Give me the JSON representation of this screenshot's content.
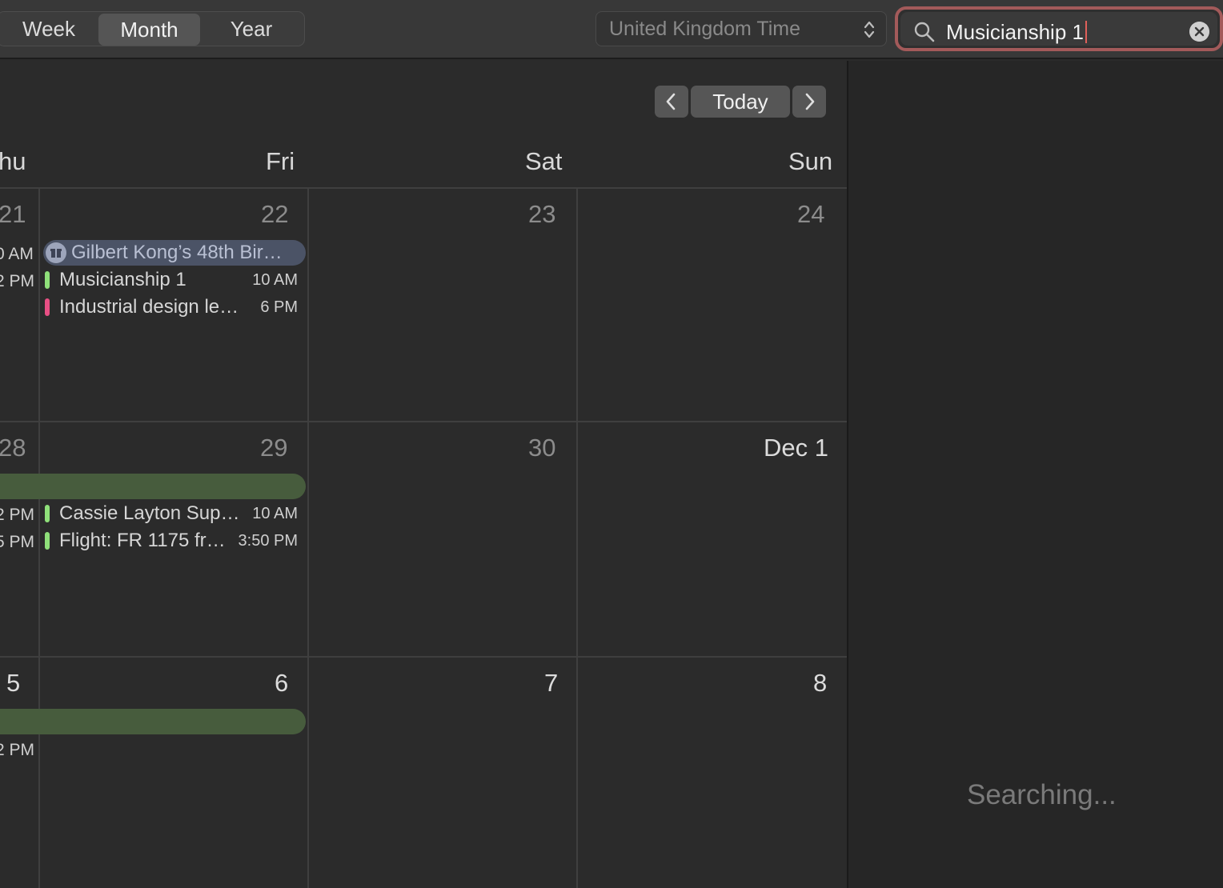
{
  "toolbar": {
    "views": [
      "Week",
      "Month",
      "Year"
    ],
    "selected_view": "Month",
    "timezone": "United Kingdom Time",
    "search_query": "Musicianship 1"
  },
  "nav": {
    "today_label": "Today"
  },
  "weekdays": [
    "hu",
    "Fri",
    "Sat",
    "Sun"
  ],
  "weeks": [
    {
      "days": [
        "21",
        "22",
        "23",
        "24"
      ],
      "thu_partial_times": [
        "AM",
        "PM"
      ],
      "fri_events": [
        {
          "kind": "birthday",
          "title": "Gilbert Kong’s 48th Bir…",
          "icon": "gift-icon"
        },
        {
          "title": "Musicianship 1",
          "time": "10 AM",
          "color": "#8fe07a"
        },
        {
          "title": "Industrial design le…",
          "time": "6 PM",
          "color": "#e84f84"
        }
      ]
    },
    {
      "days": [
        "28",
        "29",
        "30",
        "Dec 1"
      ],
      "thu_partial_times": [
        "PM",
        "PM"
      ],
      "fri_events": [
        {
          "title": "Cassie Layton Sup…",
          "time": "10 AM",
          "color": "#8fe07a"
        },
        {
          "title": "Flight: FR 1175 fr…",
          "time": "3:50 PM",
          "color": "#8fe07a"
        }
      ]
    },
    {
      "days": [
        "5",
        "6",
        "7",
        "8"
      ],
      "thu_partial_times": [
        "PM"
      ]
    }
  ],
  "results_panel": {
    "status": "Searching..."
  }
}
